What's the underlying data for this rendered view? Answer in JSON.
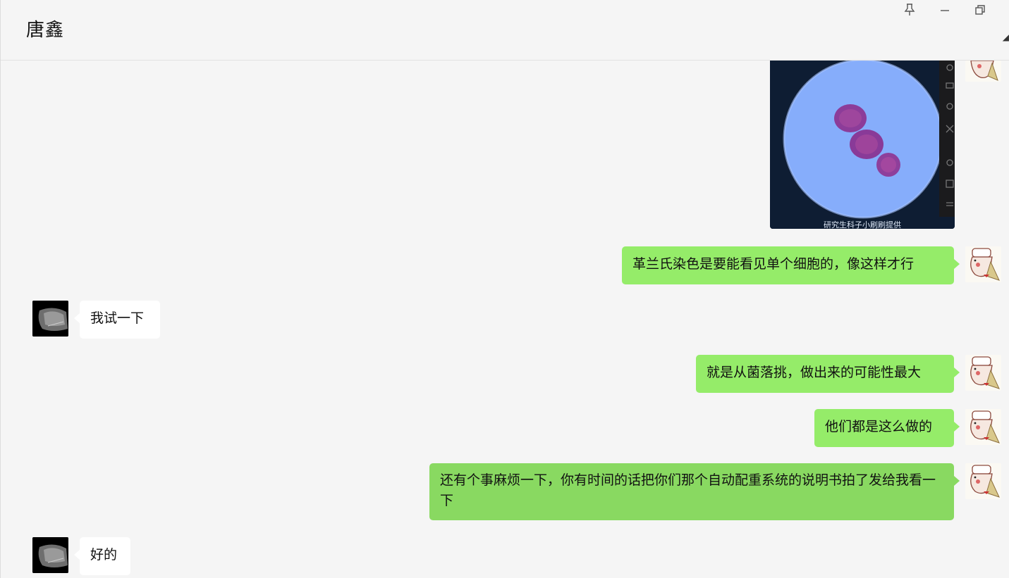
{
  "header": {
    "title": "唐鑫",
    "buttons": [
      "pin-icon",
      "minimize-icon",
      "restore-icon"
    ]
  },
  "image_message": {
    "caption": "研究生科子小刷刷提供"
  },
  "messages": [
    {
      "side": "me",
      "text": "革兰氏染色是要能看见单个细胞的，像这样才行"
    },
    {
      "side": "peer",
      "text": "我试一下"
    },
    {
      "side": "me",
      "text": "就是从菌落挑，做出来的可能性最大"
    },
    {
      "side": "me",
      "text": "他们都是这么做的"
    },
    {
      "side": "me",
      "text": "还有个事麻烦一下，你有时间的话把你们那个自动配重系统的说明书拍了发给我看一下"
    },
    {
      "side": "peer",
      "text": "好的"
    }
  ],
  "colors": {
    "my_bubble": "#95ec69",
    "peer_bubble": "#ffffff",
    "background": "#f5f5f5"
  }
}
